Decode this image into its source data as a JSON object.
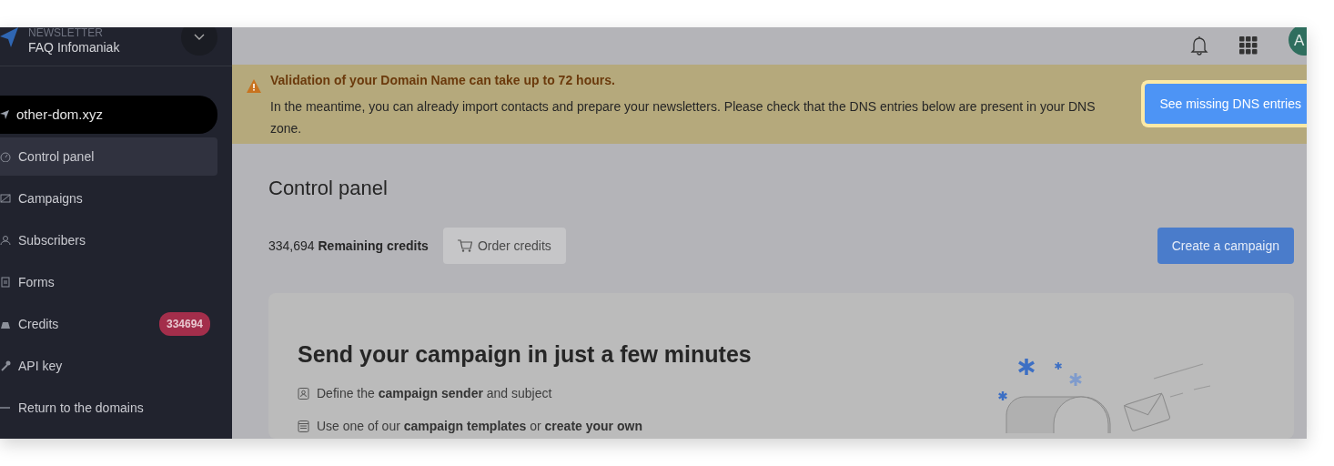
{
  "sidebar": {
    "product_label": "NEWSLETTER",
    "account": "FAQ Infomaniak",
    "domain": "other-dom.xyz",
    "items": [
      {
        "label": "Control panel",
        "kind": "gauge",
        "selected": true
      },
      {
        "label": "Campaigns",
        "kind": "mail",
        "selected": false
      },
      {
        "label": "Subscribers",
        "kind": "people",
        "selected": false
      },
      {
        "label": "Forms",
        "kind": "form",
        "selected": false
      },
      {
        "label": "Credits",
        "kind": "bag",
        "selected": false,
        "badge": "334694"
      },
      {
        "label": "API key",
        "kind": "key",
        "selected": false
      },
      {
        "label": "Return to the domains",
        "kind": "back",
        "selected": false
      }
    ]
  },
  "topbar": {
    "avatar": "A"
  },
  "alert": {
    "title": "Validation of your Domain Name can take up to 72 hours.",
    "message": "In the meantime, you can already import contacts and prepare your newsletters. Please check that the DNS entries below are present in your DNS zone.",
    "button": "See missing DNS entries"
  },
  "page": {
    "title": "Control panel",
    "credits_count": "334,694",
    "credits_label": "Remaining credits",
    "order_button": "Order credits",
    "create_button": "Create a campaign"
  },
  "hero": {
    "title": "Send your campaign in just a few minutes",
    "steps": [
      {
        "kind": "contact",
        "text": "Define the **campaign sender** and subject"
      },
      {
        "kind": "template",
        "text": "Use one of our **campaign templates** or **create your own**"
      }
    ]
  }
}
